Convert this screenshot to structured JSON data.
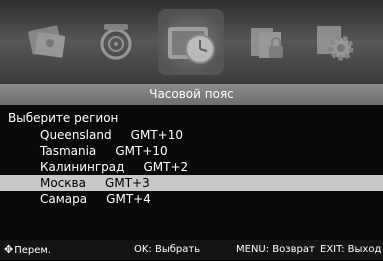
{
  "menu_icons": [
    {
      "name": "picture-icon",
      "active": false
    },
    {
      "name": "sound-icon",
      "active": false
    },
    {
      "name": "time-icon",
      "active": true
    },
    {
      "name": "lock-icon",
      "active": false
    },
    {
      "name": "settings-gear-icon",
      "active": false
    }
  ],
  "title": "Часовой пояс",
  "heading": "Выберите регион",
  "timezones": [
    {
      "label": "Queensland     GMT+10",
      "selected": false
    },
    {
      "label": "Tasmania     GMT+10",
      "selected": false
    },
    {
      "label": "Калининград     GMT+2",
      "selected": false
    },
    {
      "label": "Москва     GMT+3",
      "selected": true
    },
    {
      "label": "Самара     GMT+4",
      "selected": false
    }
  ],
  "bottom": {
    "move_glyph": "✥",
    "move": "Перем.",
    "ok": "OK: Выбрать",
    "menu": "MENU: Возврат",
    "exit": "EXIT: Выход"
  },
  "colors": {
    "title_bar": "#7a7a7a",
    "selected_row": "#c8c8c8",
    "background": "#0a0a0a"
  }
}
